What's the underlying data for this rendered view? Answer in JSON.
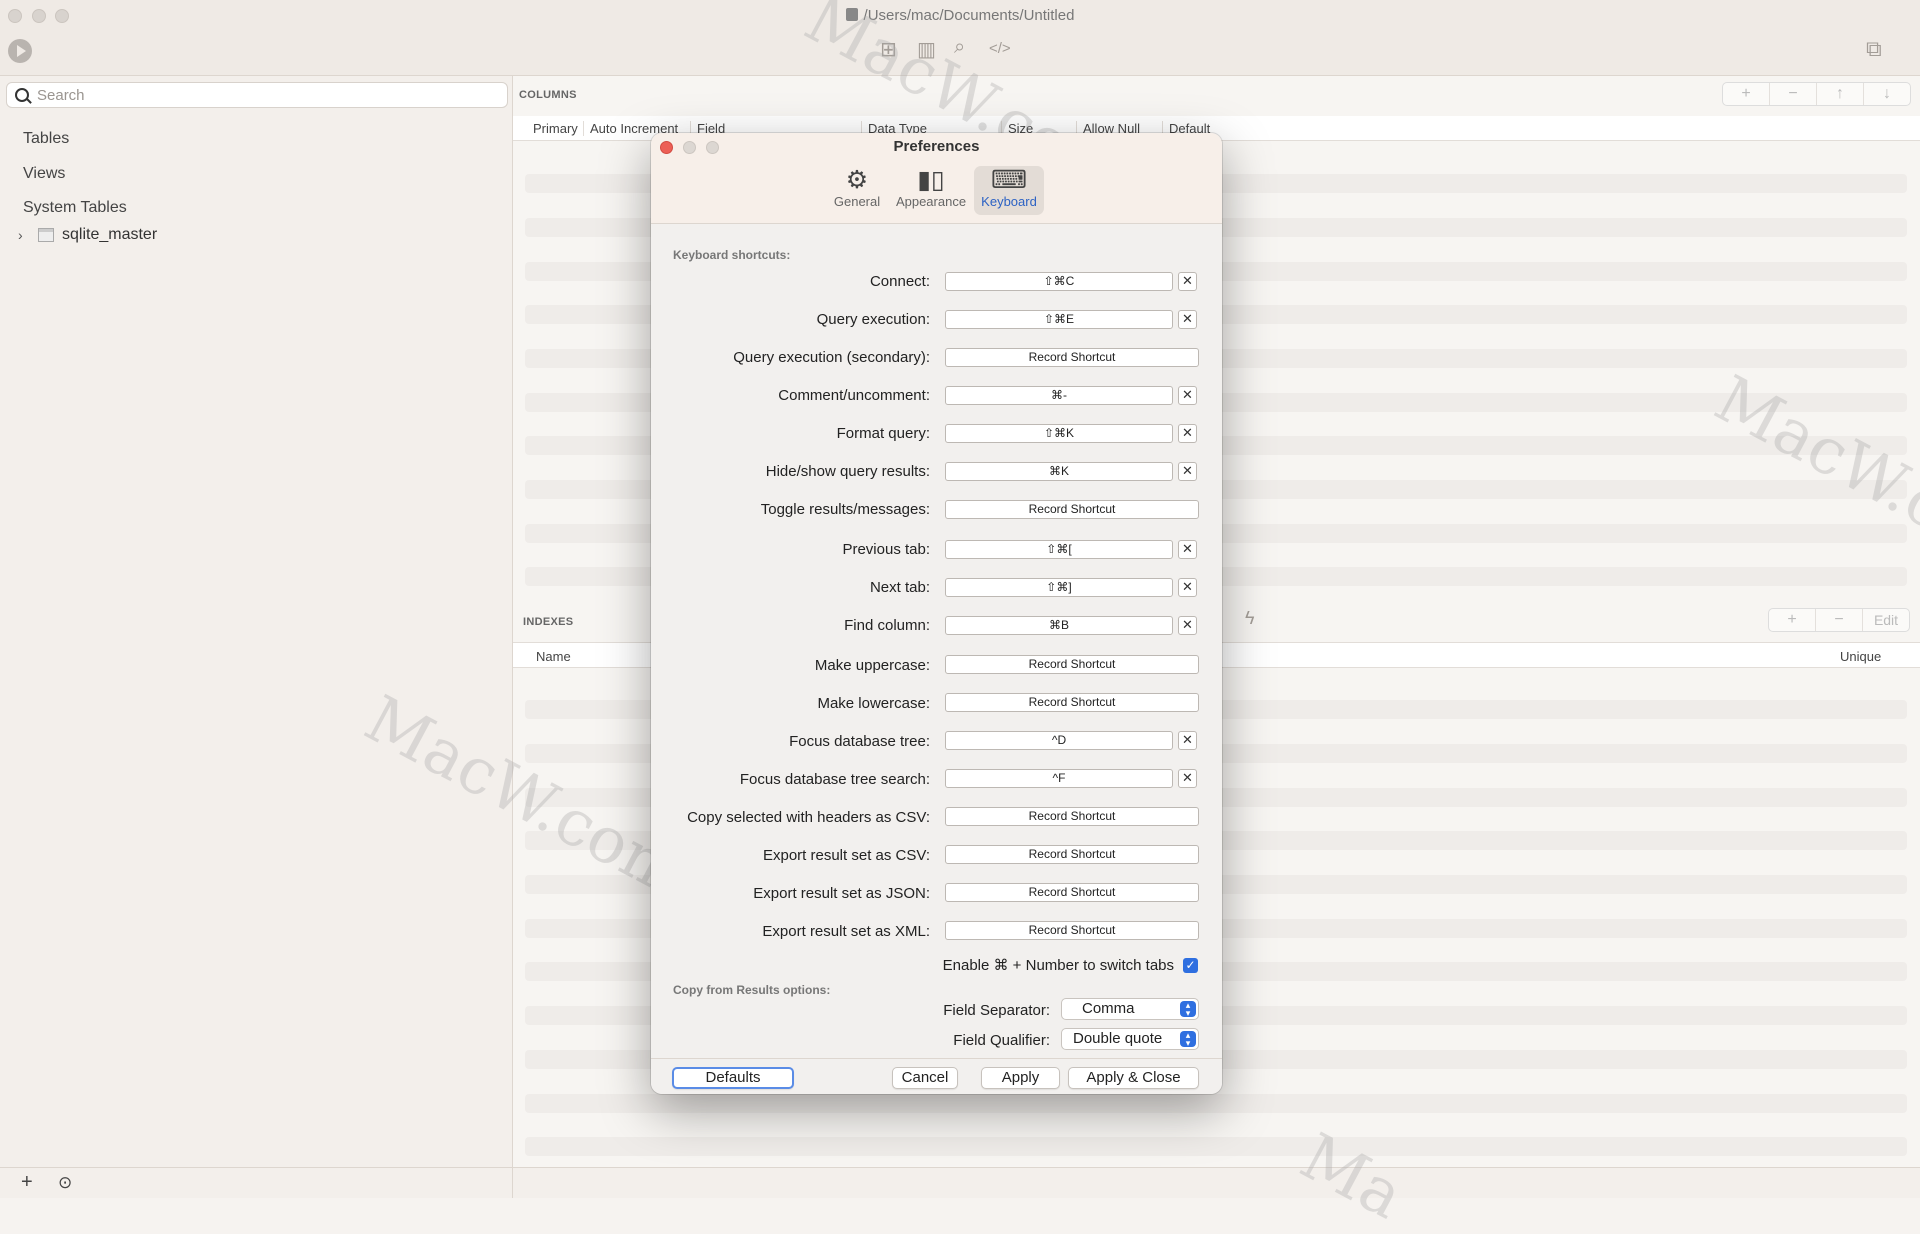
{
  "window": {
    "title": "/Users/mac/Documents/Untitled"
  },
  "toolbar": {
    "icons": [
      "play-icon",
      "structure-icon",
      "chart-icon",
      "search-icon",
      "code-icon",
      "sidebar-toggle-icon"
    ],
    "code_label": "</>"
  },
  "sidebar": {
    "search_placeholder": "Search",
    "items": [
      {
        "label": "Tables"
      },
      {
        "label": "Views"
      },
      {
        "label": "System Tables"
      }
    ],
    "tree": [
      {
        "label": "sqlite_master"
      }
    ],
    "bottom": {
      "add": "+",
      "more": "⊙"
    }
  },
  "columns": {
    "section_label": "COLUMNS",
    "headers": [
      "Primary",
      "Auto Increment",
      "Field",
      "Data Type",
      "Size",
      "Allow Null",
      "Default"
    ],
    "toolbar": [
      "+",
      "−",
      "↑",
      "↓"
    ]
  },
  "indexes": {
    "section_label": "INDEXES",
    "headers": [
      "Name",
      "Unique"
    ],
    "toolbar": [
      "+",
      "−",
      "Edit"
    ]
  },
  "watermarks": [
    "MacW.com",
    "MacW.com",
    "MacW.com",
    "Ma"
  ],
  "preferences": {
    "title": "Preferences",
    "tabs": [
      {
        "label": "General",
        "icon": "gear-icon",
        "active": false
      },
      {
        "label": "Appearance",
        "icon": "appearance-icon",
        "active": false
      },
      {
        "label": "Keyboard",
        "icon": "keyboard-icon",
        "active": true
      }
    ],
    "keyboard_group_label": "Keyboard shortcuts:",
    "shortcuts": [
      {
        "label": "Connect:",
        "value": "⇧⌘C",
        "clear": "✕"
      },
      {
        "label": "Query execution:",
        "value": "⇧⌘E",
        "clear": "✕"
      },
      {
        "label": "Query execution (secondary):",
        "value": "Record Shortcut"
      },
      {
        "label": "Comment/uncomment:",
        "value": "⌘-",
        "clear": "✕"
      },
      {
        "label": "Format query:",
        "value": "⇧⌘K",
        "clear": "✕"
      },
      {
        "label": "Hide/show query results:",
        "value": "⌘K",
        "clear": "✕"
      },
      {
        "label": "Toggle results/messages:",
        "value": "Record Shortcut"
      },
      {
        "label": "Previous tab:",
        "value": "⇧⌘[",
        "clear": "✕"
      },
      {
        "label": "Next tab:",
        "value": "⇧⌘]",
        "clear": "✕"
      },
      {
        "label": "Find column:",
        "value": "⌘B",
        "clear": "✕"
      },
      {
        "label": "Make uppercase:",
        "value": "Record Shortcut"
      },
      {
        "label": "Make lowercase:",
        "value": "Record Shortcut"
      },
      {
        "label": "Focus database tree:",
        "value": "^D",
        "clear": "✕"
      },
      {
        "label": "Focus database tree search:",
        "value": "^F",
        "clear": "✕"
      },
      {
        "label": "Copy selected with headers as CSV:",
        "value": "Record Shortcut"
      },
      {
        "label": "Export result set as CSV:",
        "value": "Record Shortcut"
      },
      {
        "label": "Export result set as JSON:",
        "value": "Record Shortcut"
      },
      {
        "label": "Export result set as XML:",
        "value": "Record Shortcut"
      }
    ],
    "switch_tabs": {
      "label": "Enable ⌘ + Number to switch tabs",
      "checked": true,
      "mark": "✓"
    },
    "copy_group_label": "Copy from Results options:",
    "field_separator": {
      "label": "Field Separator:",
      "value": "Comma"
    },
    "field_qualifier": {
      "label": "Field Qualifier:",
      "value": "Double quote"
    },
    "buttons": {
      "defaults": "Defaults",
      "cancel": "Cancel",
      "apply": "Apply",
      "apply_close": "Apply & Close"
    }
  },
  "colors": {
    "accent": "#2f6fe0",
    "close_red": "#ec5f56",
    "active_tab_text": "#2c62c4"
  }
}
